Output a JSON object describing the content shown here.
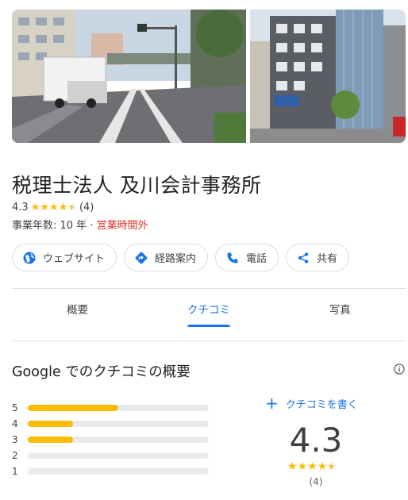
{
  "place": {
    "name": "税理士法人 及川会計事務所",
    "rating": "4.3",
    "review_count": "(4)",
    "stars_filled": 4.5,
    "years_in_business": "事業年数: 10 年 · ",
    "hours_status": "営業時間外"
  },
  "actions": [
    {
      "label": "ウェブサイト",
      "icon": "globe-icon"
    },
    {
      "label": "経路案内",
      "icon": "directions-icon"
    },
    {
      "label": "電話",
      "icon": "phone-icon"
    },
    {
      "label": "共有",
      "icon": "share-icon"
    }
  ],
  "tabs": [
    {
      "label": "概要",
      "active": false
    },
    {
      "label": "クチコミ",
      "active": true
    },
    {
      "label": "写真",
      "active": false
    }
  ],
  "reviews": {
    "title": "Google でのクチコミの概要",
    "write_label": "クチコミを書く",
    "score": "4.3",
    "count": "(4)",
    "distribution": [
      {
        "stars": "5",
        "fraction": 0.5
      },
      {
        "stars": "4",
        "fraction": 0.25
      },
      {
        "stars": "3",
        "fraction": 0.25
      },
      {
        "stars": "2",
        "fraction": 0
      },
      {
        "stars": "1",
        "fraction": 0
      }
    ]
  },
  "colors": {
    "accent": "#1a73e8",
    "star": "#fbbc04",
    "closed": "#d93025"
  }
}
